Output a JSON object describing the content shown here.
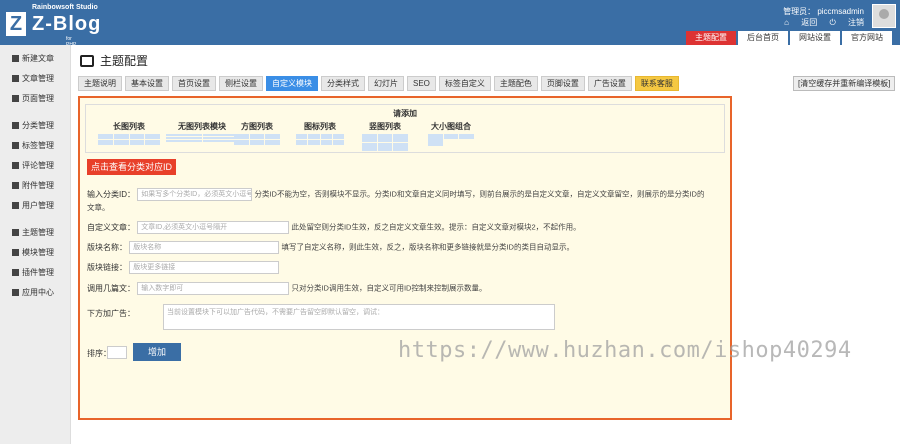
{
  "header": {
    "studio": "Rainbowsoft Studio",
    "brand_letter": "Z",
    "brand": "Z-Blog",
    "brand_sub": "for PHP",
    "user_label": "管理员： piccmsadmin",
    "back_link": "返回",
    "logout_link": "注销",
    "tabs": [
      "主题配置",
      "后台首页",
      "网站设置",
      "官方网站"
    ]
  },
  "sidebar": {
    "items": [
      "新建文章",
      "文章管理",
      "页面管理",
      "分类管理",
      "标签管理",
      "评论管理",
      "附件管理",
      "用户管理",
      "主题管理",
      "模块管理",
      "插件管理",
      "应用中心"
    ]
  },
  "main": {
    "title": "主题配置",
    "tabs": [
      "主题说明",
      "基本设置",
      "首页设置",
      "侧栏设置",
      "自定义模块",
      "分类样式",
      "幻灯片",
      "SEO",
      "标签自定义",
      "主题配色",
      "页脚设置",
      "广告设置",
      "联系客服"
    ],
    "active_tab": "自定义模块",
    "clear_button": "[清空缓存并重新编译模板]"
  },
  "panel": {
    "add_title": "请添加",
    "modules": [
      "长图列表",
      "无图列表模块",
      "方图列表",
      "图标列表",
      "竖图列表",
      "大小图组合"
    ],
    "view_button": "点击查看分类对应ID",
    "fields": {
      "category_label": "输入分类ID：",
      "category_placeholder": "如果写多个分类ID，必须英文小逗号隔开",
      "category_hint": "分类ID不能为空，否则模块不显示。分类ID和文章自定义同时填写，则前台展示的是自定义文章，自定义文章留空，则展示的是分类ID的",
      "category_hint2": "文章。",
      "custom_label": "自定义文章：",
      "custom_placeholder": "文章ID,必须英文小逗号隔开",
      "custom_hint": "此处留空则分类ID生效，反之自定义文章生效。提示：自定义文章对模块2，不起作用。",
      "block_name_label": "版块名称：",
      "block_name_placeholder": "版块名称",
      "block_name_hint": "填写了自定义名称，则此生效，反之，版块名称和更多链接就是分类ID的类目自动显示。",
      "block_link_label": "版块链接：",
      "block_link_placeholder": "版块更多链接",
      "count_label": "调用几篇文：",
      "count_placeholder": "输入数字即可",
      "count_hint": "只对分类ID调用生效，自定义可用ID控制来控制展示数量。",
      "ad_label": "下方加广告：",
      "ad_placeholder": "当前设置模块下可以加广告代码，不需要广告留空即默认留空，调试：",
      "sort_label": "排序：",
      "add_button": "增加"
    }
  },
  "watermark": "https://www.huzhan.com/ishop40294",
  "colors": {
    "header": "#3a6ea5",
    "active_top_tab": "#dd3333",
    "active_tab": "#3a8ee6",
    "panel_border": "#e8642a",
    "red_button": "#e8402a"
  }
}
